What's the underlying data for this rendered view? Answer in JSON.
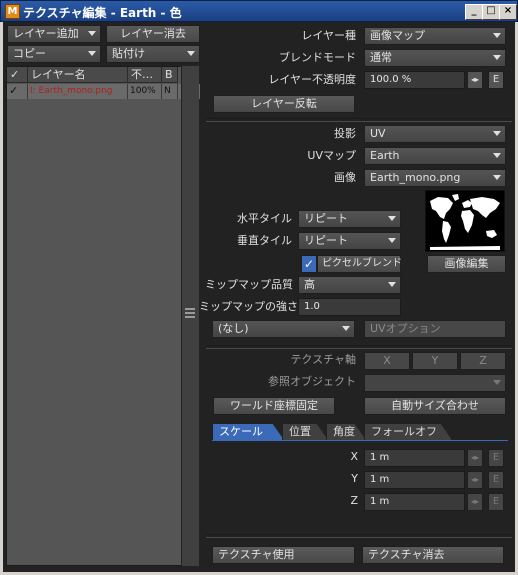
{
  "window": {
    "title": "テクスチャ編集 - Earth - 色",
    "app_icon_text": "M",
    "controls": {
      "minimize": "_",
      "maximize": "□",
      "close": "×"
    }
  },
  "left": {
    "add_layer": "レイヤー追加",
    "delete_layer": "レイヤー消去",
    "copy": "コピー",
    "paste": "貼付け",
    "columns": {
      "check": "✓",
      "name": "レイヤー名",
      "opacity": "不…",
      "blend": "B"
    },
    "rows": [
      {
        "check": "✓",
        "name": "I: Earth_mono.png",
        "opacity": "100%",
        "blend": "N"
      }
    ]
  },
  "layer": {
    "type_label": "レイヤー種",
    "type_value": "画像マップ",
    "blend_label": "ブレンドモード",
    "blend_value": "通常",
    "opacity_label": "レイヤー不透明度",
    "opacity_value": "100.0 %",
    "env_icon": "◂▸",
    "env_e": "E",
    "invert_button": "レイヤー反転"
  },
  "projection": {
    "proj_label": "投影",
    "proj_value": "UV",
    "uvmap_label": "UVマップ",
    "uvmap_value": "Earth",
    "image_label": "画像",
    "image_value": "Earth_mono.png",
    "htile_label": "水平タイル",
    "htile_value": "リピート",
    "vtile_label": "垂直タイル",
    "vtile_value": "リピート",
    "pixel_blend_label": "ピクセルブレンド",
    "pixel_blend_checked": true,
    "image_edit_button": "画像編集",
    "mip_quality_label": "ミップマップ品質",
    "mip_quality_value": "高",
    "mip_strength_label": "ミップマップの強さ",
    "mip_strength_value": "1.0",
    "node_value": "(なし)",
    "uv_option_button": "UVオプション"
  },
  "axis": {
    "axis_label": "テクスチャ軸",
    "x": "X",
    "y": "Y",
    "z": "Z",
    "ref_object_label": "参照オブジェクト",
    "ref_object_value": "",
    "world_coord_button": "ワールド座標固定",
    "auto_size_button": "自動サイズ合わせ"
  },
  "tabs": [
    "スケール",
    "位置",
    "角度",
    "フォールオフ"
  ],
  "active_tab": 0,
  "scale": {
    "x_label": "X",
    "x_value": "1 m",
    "y_label": "Y",
    "y_value": "1 m",
    "z_label": "Z",
    "z_value": "1 m"
  },
  "footer": {
    "use_texture": "テクスチャ使用",
    "delete_texture": "テクスチャ消去"
  },
  "colors": {
    "accent": "#3b6ab8",
    "panel": "#2c2c2c",
    "title_bar": "#1c3f82"
  }
}
